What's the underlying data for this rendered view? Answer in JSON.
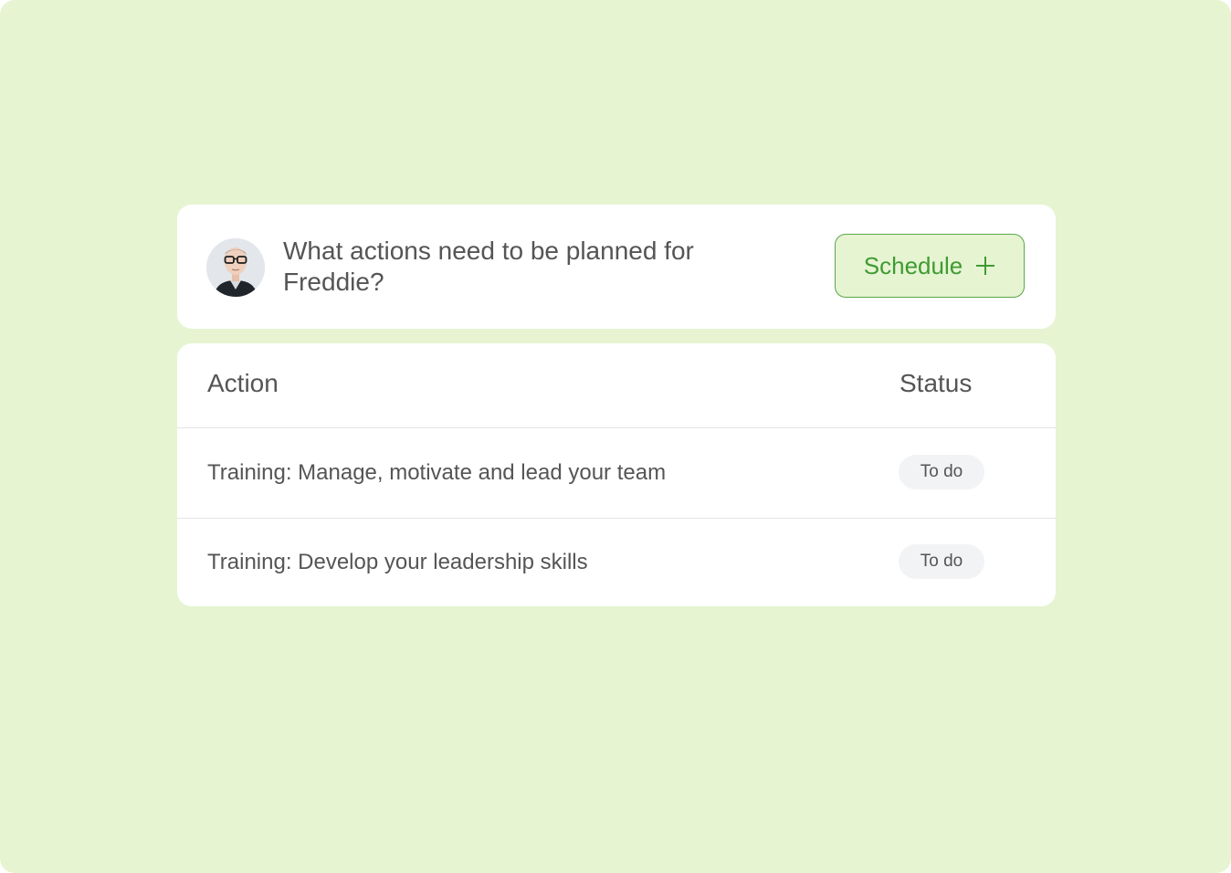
{
  "prompt": {
    "question": "What actions need to be planned for Freddie?",
    "avatar_icon": "person-photo-icon"
  },
  "schedule_button": {
    "label": "Schedule",
    "icon": "plus-icon"
  },
  "table": {
    "headers": {
      "action": "Action",
      "status": "Status"
    },
    "rows": [
      {
        "action": "Training: Manage, motivate and lead your team",
        "status": "To do"
      },
      {
        "action": "Training: Develop your leadership skills",
        "status": "To do"
      }
    ]
  },
  "colors": {
    "background": "#e6f4d2",
    "accent": "#3f9b32",
    "text": "#555555",
    "badge_background": "#f2f3f5"
  }
}
